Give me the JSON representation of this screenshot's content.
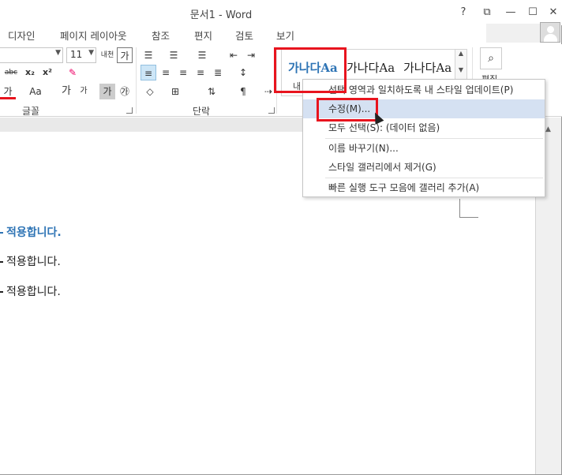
{
  "window": {
    "title": "문서1 - Word",
    "help_label": "?",
    "ribbon_display_label": "⧉",
    "minimize_label": "—",
    "maximize_label": "☐",
    "close_label": "✕"
  },
  "tabs": [
    {
      "label": "디자인"
    },
    {
      "label": "페이지 레이아웃"
    },
    {
      "label": "참조"
    },
    {
      "label": "편지"
    },
    {
      "label": "검토"
    },
    {
      "label": "보기"
    }
  ],
  "ribbon": {
    "font_size_value": "11",
    "font_group_label": "글꼴",
    "paragraph_group_label": "단락",
    "edit_label": "편집",
    "font_buttons": {
      "strike": "abc",
      "subscript": "x₂",
      "superscript": "x²",
      "font_color": "가",
      "text_effects": "Aa",
      "grow": "가",
      "shrink": "가",
      "phonetic": "내천",
      "char_border": "가",
      "char_shading": "가",
      "enclose": "㉮"
    }
  },
  "style_gallery": {
    "tiles": [
      {
        "sample": "가나다Aa",
        "name": "내",
        "color": "#2e74b5"
      },
      {
        "sample": "가나다Aa",
        "name": "",
        "color": "#222222"
      },
      {
        "sample": "가나다Aa",
        "name": "",
        "color": "#222222"
      }
    ]
  },
  "context_menu": {
    "items": [
      {
        "label": "선택 영역과 일치하도록 내 스타일 업데이트(P)"
      },
      {
        "label": "수정(M)..."
      },
      {
        "label": "모두 선택(S): (데이터 없음)"
      },
      {
        "label": "이름 바꾸기(N)..."
      },
      {
        "label": "스타일 갤러리에서 제거(G)"
      },
      {
        "label": "빠른 실행 도구 모음에 갤러리 추가(A)"
      }
    ]
  },
  "document": {
    "lines": [
      {
        "text": "적용합니다."
      },
      {
        "text": "적용합니다."
      },
      {
        "text": "적용합니다."
      }
    ]
  },
  "colors": {
    "accent": "#2e74b5",
    "highlight_border": "#e8141e",
    "menu_hover": "#d5e1f2"
  }
}
